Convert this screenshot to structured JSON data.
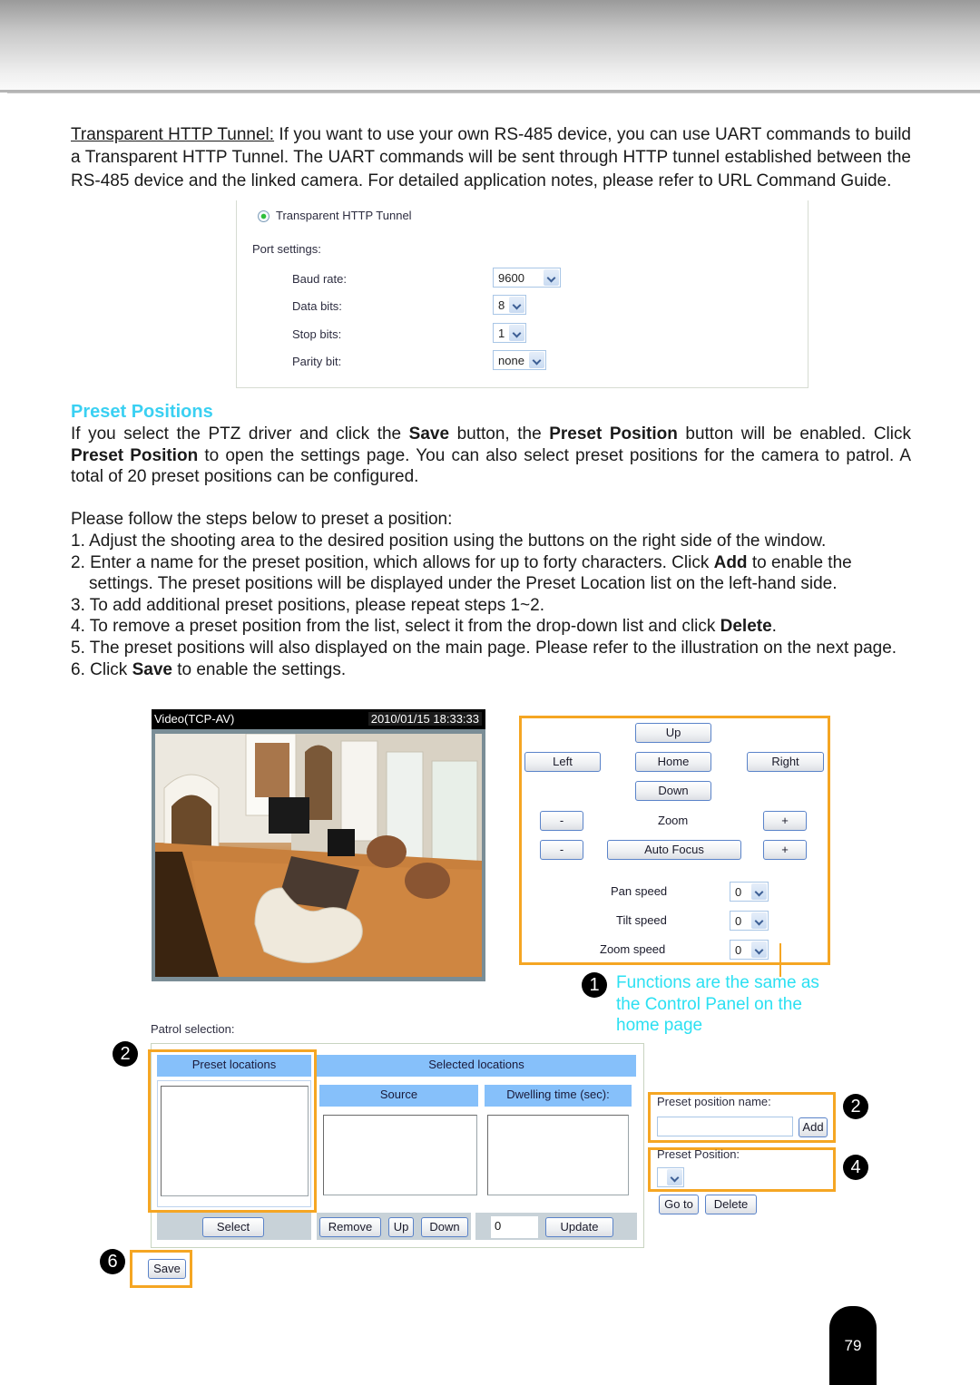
{
  "intro": {
    "link_text": "Transparent HTTP Tunnel:",
    "body": " If you want to use your own RS-485 device, you can use UART commands to build a Transparent HTTP Tunnel. The UART commands will be sent through HTTP tunnel established between the RS-485 device and the linked camera. For detailed application notes, please refer to URL Command Guide."
  },
  "tunnel_panel": {
    "radio_label": "Transparent HTTP Tunnel",
    "port_settings_label": "Port settings:",
    "fields": [
      {
        "label": "Baud rate:",
        "value": "9600"
      },
      {
        "label": "Data bits:",
        "value": "8"
      },
      {
        "label": "Stop bits:",
        "value": "1"
      },
      {
        "label": "Parity bit:",
        "value": "none"
      }
    ]
  },
  "preset_section": {
    "title": "Preset Positions",
    "p1_a": "If you select the PTZ driver and click the ",
    "p1_b": "Save",
    "p1_c": " button, the ",
    "p1_d": "Preset Position",
    "p1_e": " button will be enabled. Click ",
    "p1_f": "Preset Position",
    "p1_g": " to open the settings page. You can also select preset positions for the camera to patrol. A total of 20 preset positions can be configured.",
    "p2": "Please follow the steps below to preset a position:",
    "steps": [
      {
        "a": "1. Adjust the shooting area to the desired position using the buttons on the right side of the window.",
        "b": "",
        "c": ""
      },
      {
        "a": "2. Enter a name for the preset position, which allows for up to forty characters. Click ",
        "b": "Add",
        "c": " to enable the settings. The preset positions will be displayed under the Preset Location list on the left-hand side."
      },
      {
        "a": "3. To add additional preset positions, please repeat steps 1~2.",
        "b": "",
        "c": ""
      },
      {
        "a": "4. To remove a preset position from the list, select it from the drop-down list and click ",
        "b": "Delete",
        "c": "."
      },
      {
        "a": "5. The preset positions will also displayed on the main page. Please refer to the illustration on the next page.",
        "b": "",
        "c": ""
      },
      {
        "a": "6. Click ",
        "b": "Save",
        "c": " to enable the settings."
      }
    ]
  },
  "video": {
    "title": "Video(TCP-AV)",
    "timestamp": "2010/01/15 18:33:33"
  },
  "control_panel": {
    "up": "Up",
    "left": "Left",
    "home": "Home",
    "right": "Right",
    "down": "Down",
    "zoom_label": "Zoom",
    "minus": "-",
    "plus": "+",
    "auto_focus": "Auto Focus",
    "pan_speed_label": "Pan speed",
    "tilt_speed_label": "Tilt speed",
    "zoom_speed_label": "Zoom speed",
    "pan_speed": "0",
    "tilt_speed": "0",
    "zoom_speed": "0"
  },
  "callout": {
    "badge": "1",
    "text": "Functions are the same as the Control Panel on the home page"
  },
  "patrol": {
    "label": "Patrol selection:",
    "preset_locations": "Preset locations",
    "selected_locations": "Selected locations",
    "source": "Source",
    "dwelling": "Dwelling time (sec):",
    "select": "Select",
    "remove": "Remove",
    "up": "Up",
    "down": "Down",
    "dwell_value": "0",
    "update": "Update",
    "save": "Save"
  },
  "right_panel": {
    "name_label": "Preset position name:",
    "add": "Add",
    "position_label": "Preset Position:",
    "goto": "Go to",
    "delete": "Delete"
  },
  "badges": {
    "b2_left": "2",
    "b2_right": "2",
    "b4": "4",
    "b6": "6"
  },
  "page_number": "79"
}
